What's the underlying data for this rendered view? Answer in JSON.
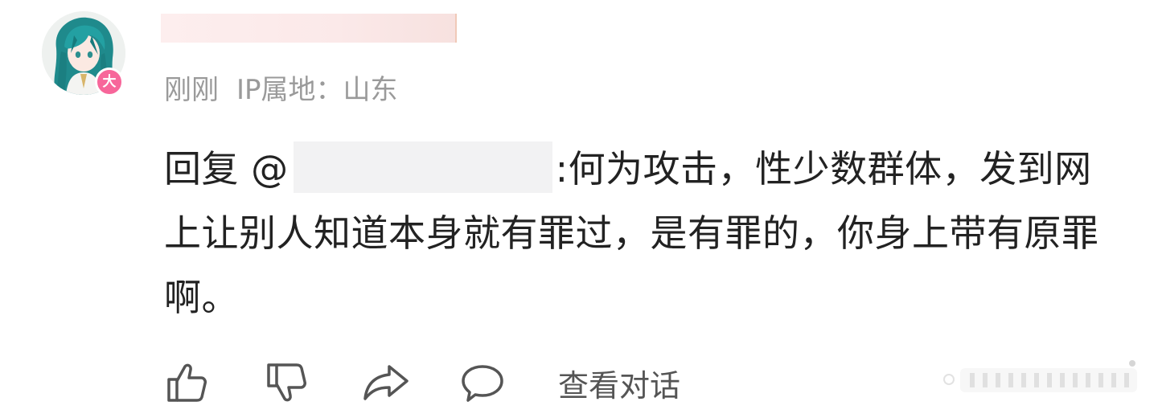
{
  "comment": {
    "avatar_badge": "大",
    "meta": {
      "time": "刚刚",
      "ip_location": "IP属地：山东"
    },
    "body": {
      "reply_prefix": "回复 @",
      "text_after_mention": ":何为攻击，性少数群体，发到网上让别人知道本身就有罪过，是有罪的，你身上带有原罪啊。"
    },
    "actions": {
      "like_icon": "thumbs-up-icon",
      "dislike_icon": "thumbs-down-icon",
      "share_icon": "share-arrow-icon",
      "reply_icon": "speech-bubble-icon",
      "view_conversation": "查看对话"
    }
  },
  "colors": {
    "badge": "#f7669a",
    "meta_text": "#9a9a9a",
    "body_text": "#222222",
    "icon_stroke": "#555555"
  }
}
